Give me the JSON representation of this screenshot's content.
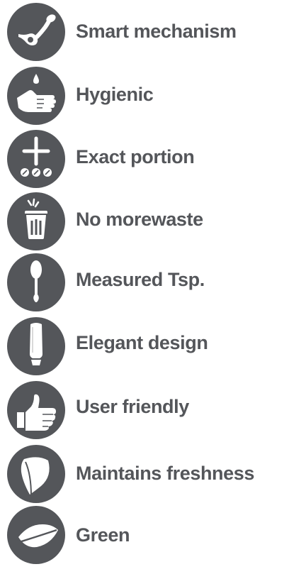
{
  "colors": {
    "icon_background": "#54565a",
    "icon_glyph": "#ffffff",
    "label_text": "#54565a"
  },
  "features": [
    {
      "label": "Smart mechanism",
      "icon": "dispenser-mechanism-icon"
    },
    {
      "label": "Hygienic",
      "icon": "hand-drop-icon"
    },
    {
      "label": "Exact portion",
      "icon": "portion-plus-icon"
    },
    {
      "label": "No morewaste",
      "icon": "trash-bin-icon"
    },
    {
      "label": "Measured Tsp.",
      "icon": "spoon-icon"
    },
    {
      "label": "Elegant design",
      "icon": "bottle-icon"
    },
    {
      "label": "User friendly",
      "icon": "thumbs-up-icon"
    },
    {
      "label": "Maintains freshness",
      "icon": "leaf-icon"
    },
    {
      "label": "Green",
      "icon": "green-leaf-icon"
    }
  ]
}
